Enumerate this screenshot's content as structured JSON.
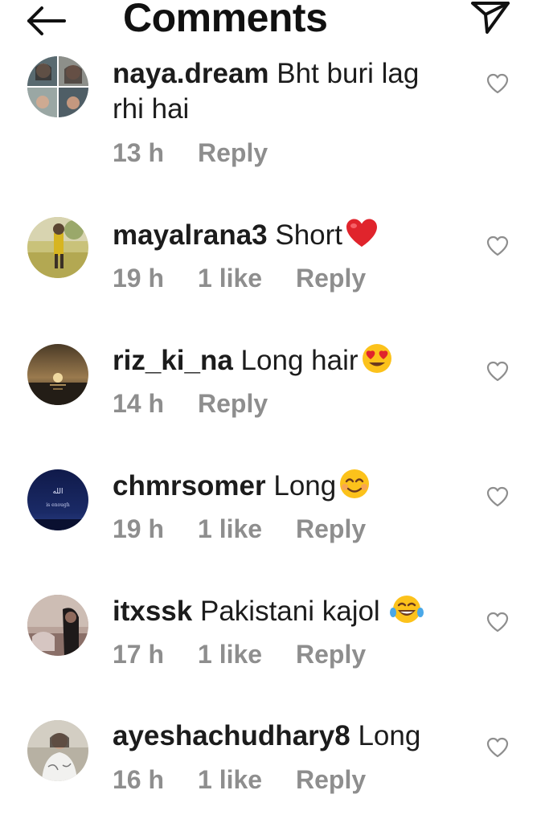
{
  "header": {
    "title": "Comments",
    "back_icon": "arrow-left-icon",
    "share_icon": "paper-plane-icon"
  },
  "colors": {
    "text": "#1c1c1c",
    "meta": "#8e8e8e",
    "heart_outline": "#8e8e8e",
    "red_heart": "#e0242c",
    "emoji_yellow": "#fcc21b"
  },
  "comments": [
    {
      "username": "naya.dream",
      "text": "Bht buri lag rhi hai",
      "emoji": "",
      "time": "13 h",
      "likes": "",
      "reply_label": "Reply"
    },
    {
      "username": "mayalrana3",
      "text": "Short",
      "emoji": "red-heart",
      "time": "19 h",
      "likes": "1 like",
      "reply_label": "Reply"
    },
    {
      "username": "riz_ki_na",
      "text": "Long hair",
      "emoji": "heart-eyes",
      "time": "14 h",
      "likes": "",
      "reply_label": "Reply"
    },
    {
      "username": "chmrsomer",
      "text": "Long",
      "emoji": "smiling-face",
      "time": "19 h",
      "likes": "1 like",
      "reply_label": "Reply"
    },
    {
      "username": "itxssk",
      "text": "Pakistani kajol",
      "emoji": "tears-of-joy",
      "time": "17 h",
      "likes": "1 like",
      "reply_label": "Reply"
    },
    {
      "username": "ayeshachudhary8",
      "text": "Long",
      "emoji": "",
      "time": "16 h",
      "likes": "1 like",
      "reply_label": "Reply"
    }
  ],
  "avatars": {
    "chmrsomer_line1": "الله",
    "chmrsomer_line2": "is enough"
  }
}
